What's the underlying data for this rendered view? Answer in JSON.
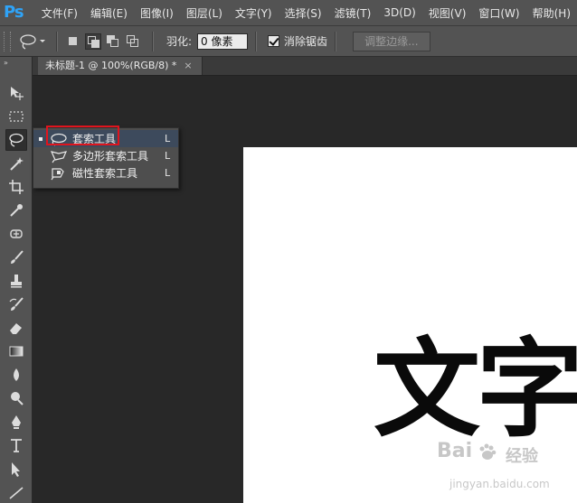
{
  "app": {
    "logo": "Ps",
    "menu": [
      "文件(F)",
      "编辑(E)",
      "图像(I)",
      "图层(L)",
      "文字(Y)",
      "选择(S)",
      "滤镜(T)",
      "3D(D)",
      "视图(V)",
      "窗口(W)",
      "帮助(H)"
    ]
  },
  "options": {
    "feather_label": "羽化:",
    "feather_value": "0 像素",
    "antialias_label": "消除锯齿",
    "antialias_checked": true,
    "refine_edge": "调整边缘..."
  },
  "toolbar": {
    "collapse": "»",
    "tools": [
      "move-icon",
      "marquee-icon",
      "lasso-icon",
      "magic-wand-icon",
      "crop-icon",
      "eyedropper-icon",
      "healing-icon",
      "brush-icon",
      "stamp-icon",
      "history-brush-icon",
      "eraser-icon",
      "gradient-icon",
      "blur-icon",
      "dodge-icon",
      "pen-icon",
      "type-icon",
      "path-select-icon",
      "shape-icon"
    ]
  },
  "document": {
    "tab_title": "未标题-1 @ 100%(RGB/8) *",
    "close": "×",
    "canvas_text": "文字"
  },
  "flyout": {
    "items": [
      {
        "label": "套索工具",
        "key": "L",
        "icon": "lasso-icon",
        "selected": true
      },
      {
        "label": "多边形套索工具",
        "key": "L",
        "icon": "polygonal-lasso-icon",
        "selected": false
      },
      {
        "label": "磁性套索工具",
        "key": "L",
        "icon": "magnetic-lasso-icon",
        "selected": false
      }
    ]
  },
  "colors": {
    "highlight": "#e0141d",
    "ps_blue": "#2fa3f7"
  },
  "watermark": {
    "brand": "Bai",
    "brand_cn": "经验",
    "url": "jingyan.baidu.com"
  }
}
